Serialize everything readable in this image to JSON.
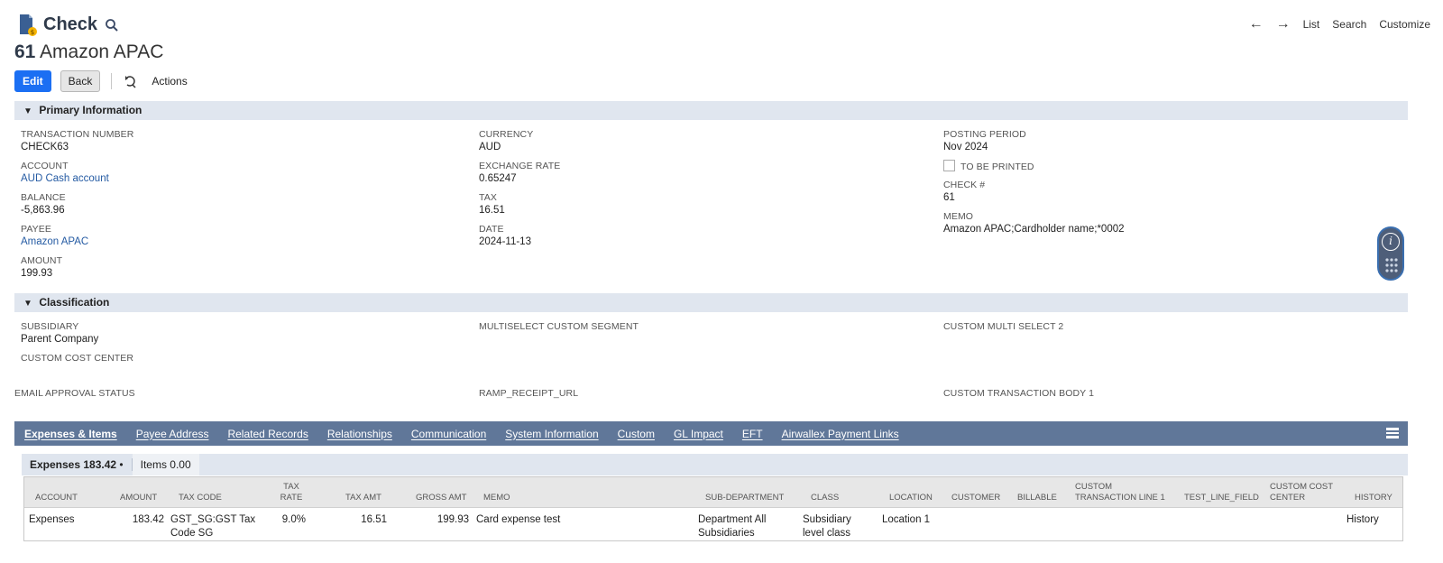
{
  "header": {
    "record_type": "Check",
    "number": "61",
    "entity": "Amazon APAC",
    "nav": {
      "back_arrow": "←",
      "forward_arrow": "→",
      "list": "List",
      "search": "Search",
      "customize": "Customize"
    }
  },
  "buttons": {
    "edit": "Edit",
    "back": "Back",
    "actions": "Actions"
  },
  "primary": {
    "title": "Primary Information",
    "transaction_number": {
      "label": "TRANSACTION NUMBER",
      "value": "CHECK63"
    },
    "account": {
      "label": "ACCOUNT",
      "value": "AUD Cash account"
    },
    "balance": {
      "label": "BALANCE",
      "value": "-5,863.96"
    },
    "payee": {
      "label": "PAYEE",
      "value": "Amazon APAC"
    },
    "amount": {
      "label": "AMOUNT",
      "value": "199.93"
    },
    "currency": {
      "label": "CURRENCY",
      "value": "AUD"
    },
    "exchange_rate": {
      "label": "EXCHANGE RATE",
      "value": "0.65247"
    },
    "tax": {
      "label": "TAX",
      "value": "16.51"
    },
    "date": {
      "label": "DATE",
      "value": "2024-11-13"
    },
    "posting_period": {
      "label": "POSTING PERIOD",
      "value": "Nov 2024"
    },
    "to_be_printed": {
      "label": "TO BE PRINTED",
      "checked": false
    },
    "check_no": {
      "label": "CHECK #",
      "value": "61"
    },
    "memo": {
      "label": "MEMO",
      "value": "Amazon APAC;Cardholder name;*0002"
    }
  },
  "classification": {
    "title": "Classification",
    "subsidiary": {
      "label": "SUBSIDIARY",
      "value": "Parent Company"
    },
    "custom_cost_center": {
      "label": "CUSTOM COST CENTER"
    },
    "multiselect_custom_segment": {
      "label": "MULTISELECT CUSTOM SEGMENT"
    },
    "custom_multi_select_2": {
      "label": "CUSTOM MULTI SELECT 2"
    },
    "email_approval_status": {
      "label": "EMAIL APPROVAL STATUS"
    },
    "ramp_receipt_url": {
      "label": "RAMP_RECEIPT_URL"
    },
    "custom_transaction_body_1": {
      "label": "CUSTOM TRANSACTION BODY 1"
    }
  },
  "tabs": [
    "Expenses & Items",
    "Payee Address",
    "Related Records",
    "Relationships",
    "Communication",
    "System Information",
    "Custom",
    "GL Impact",
    "EFT",
    "Airwallex Payment Links"
  ],
  "subtabs": {
    "expenses": "Expenses 183.42",
    "dot": "•",
    "items": "Items 0.00"
  },
  "table": {
    "headers": {
      "account": "ACCOUNT",
      "amount": "AMOUNT",
      "tax_code": "TAX CODE",
      "tax_rate": "TAX RATE",
      "tax_amt": "TAX AMT",
      "gross_amt": "GROSS AMT",
      "memo": "MEMO",
      "sub_department": "SUB-DEPARTMENT",
      "class": "CLASS",
      "location": "LOCATION",
      "customer": "CUSTOMER",
      "billable": "BILLABLE",
      "custom_transaction_line_1": "CUSTOM TRANSACTION LINE 1",
      "test_line_field": "TEST_LINE_FIELD",
      "custom_cost_center": "CUSTOM COST CENTER",
      "history": "HISTORY"
    },
    "row": {
      "account": "Expenses",
      "amount": "183.42",
      "tax_code": "GST_SG:GST Tax Code SG",
      "tax_rate": "9.0%",
      "tax_amt": "16.51",
      "gross_amt": "199.93",
      "memo": "Card expense test",
      "sub_department": "Department All Subsidiaries",
      "class": "Subsidiary level class",
      "location": "Location 1",
      "history": "History"
    }
  },
  "widget": {
    "info_glyph": "i"
  },
  "colors": {
    "primary_button": "#1b6ff3",
    "tab_bar": "#607799",
    "section_header": "#e0e6ef",
    "link": "#255ba3"
  }
}
